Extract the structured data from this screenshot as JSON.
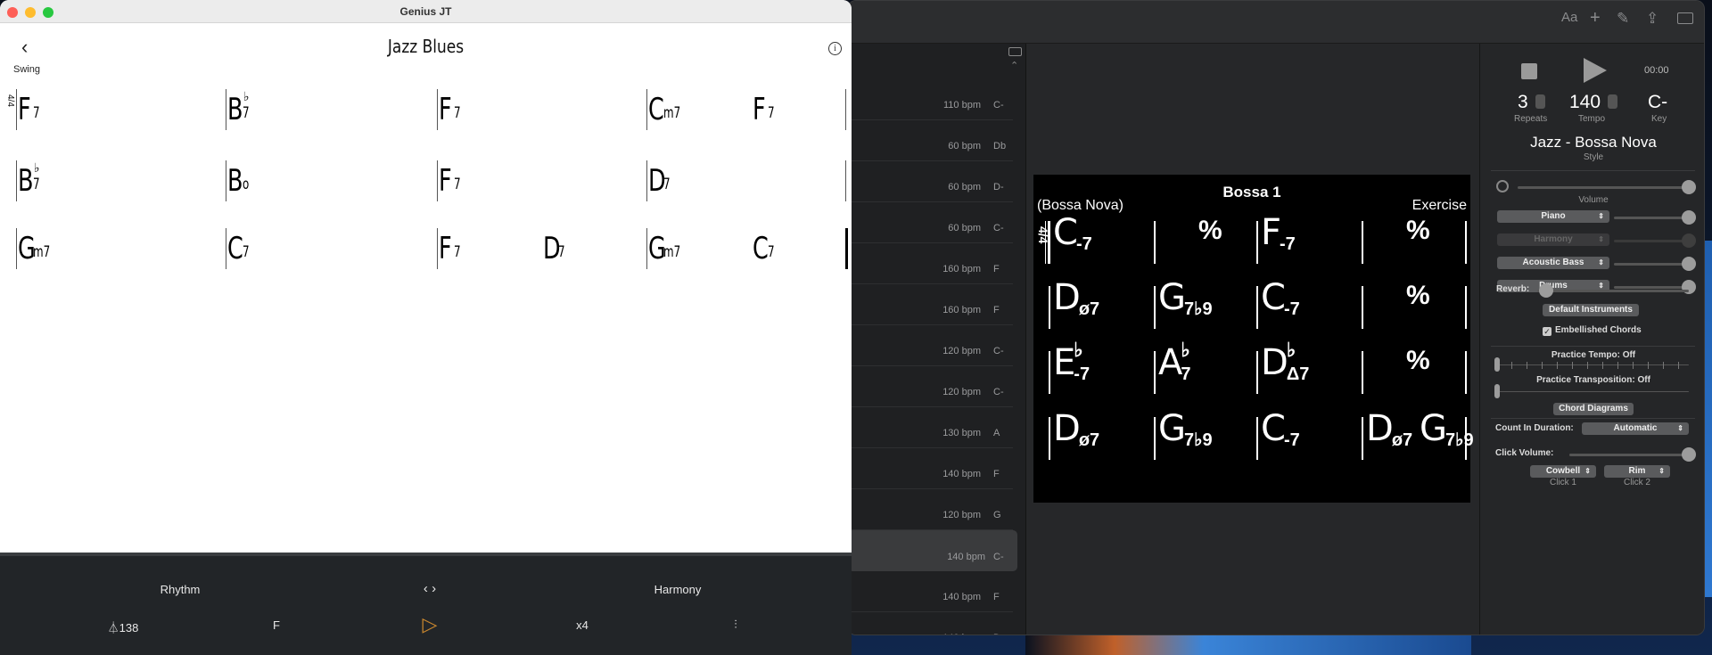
{
  "main_window": {
    "toolbar": {
      "icons": [
        "font-icon",
        "plus-icon",
        "pencil-icon",
        "share-icon",
        "sidebar-icon"
      ],
      "font_label": "Aa"
    },
    "list": {
      "rows": [
        {
          "tempo": "110 bpm",
          "key": "C-"
        },
        {
          "tempo": "60 bpm",
          "key": "Db"
        },
        {
          "tempo": "60 bpm",
          "key": "D-"
        },
        {
          "tempo": "60 bpm",
          "key": "C-"
        },
        {
          "tempo": "160 bpm",
          "key": "F"
        },
        {
          "tempo": "160 bpm",
          "key": "F"
        },
        {
          "tempo": "120 bpm",
          "key": "C-"
        },
        {
          "tempo": "120 bpm",
          "key": "C-"
        },
        {
          "tempo": "130 bpm",
          "key": "A"
        },
        {
          "tempo": "140 bpm",
          "key": "F"
        },
        {
          "tempo": "120 bpm",
          "key": "G"
        },
        {
          "tempo": "140 bpm",
          "key": "C-",
          "selected": true
        },
        {
          "tempo": "140 bpm",
          "key": "F"
        },
        {
          "tempo": "140 bpm",
          "key": "D-"
        }
      ]
    },
    "chart": {
      "title": "Bossa 1",
      "style": "(Bossa Nova)",
      "composer": "Exercise",
      "time_signature": "4/4",
      "rows": [
        [
          [
            "C",
            "",
            "-7"
          ],
          [
            "%"
          ],
          [
            "F",
            "",
            "-7"
          ],
          [
            "%"
          ]
        ],
        [
          [
            "D",
            "",
            "ø7"
          ],
          [
            "G",
            "",
            "7♭9"
          ],
          [
            "C",
            "",
            "-7"
          ],
          [
            "%"
          ]
        ],
        [
          [
            "E",
            "♭",
            "-7"
          ],
          [
            "A",
            "♭",
            "7"
          ],
          [
            "D",
            "♭",
            "Δ7"
          ],
          [
            "%"
          ]
        ],
        [
          [
            "D",
            "",
            "ø7"
          ],
          [
            "G",
            "",
            "7♭9"
          ],
          [
            "C",
            "",
            "-7"
          ],
          [
            "D",
            "",
            "ø7",
            "G",
            "",
            "7♭9"
          ]
        ]
      ]
    },
    "panel": {
      "time": "00:00",
      "repeats": "3",
      "repeats_label": "Repeats",
      "tempo": "140",
      "tempo_label": "Tempo",
      "key": "C-",
      "key_label": "Key",
      "style": "Jazz - Bossa Nova",
      "style_label": "Style",
      "volume_label": "Volume",
      "instruments": [
        {
          "name": "Piano",
          "level": 1.0,
          "enabled": true
        },
        {
          "name": "Harmony",
          "level": 1.0,
          "enabled": false
        },
        {
          "name": "Acoustic Bass",
          "level": 1.0,
          "enabled": true
        },
        {
          "name": "Drums",
          "level": 1.0,
          "enabled": true
        }
      ],
      "volume_level": 1.0,
      "reverb_label": "Reverb:",
      "reverb_level": 0.06,
      "default_instruments": "Default Instruments",
      "embellished_chords": "Embellished Chords",
      "embellished_checked": true,
      "practice_tempo": "Practice Tempo: Off",
      "practice_transposition": "Practice Transposition: Off",
      "chord_diagrams": "Chord Diagrams",
      "count_in_label": "Count In Duration:",
      "count_in_value": "Automatic",
      "click_volume_label": "Click Volume:",
      "click_volume_level": 1.0,
      "click1": "Cowbell",
      "click1_label": "Click 1",
      "click2": "Rim",
      "click2_label": "Click 2"
    }
  },
  "genius": {
    "window_title": "Genius JT",
    "song_title": "Jazz Blues",
    "style": "Swing",
    "time_signature": "4/4",
    "rows": [
      [
        [
          [
            "F",
            "",
            "7"
          ]
        ],
        [
          [
            "B",
            "♭",
            "7"
          ]
        ],
        [
          [
            "F",
            "",
            "7"
          ]
        ],
        [
          [
            "C",
            "",
            "m7"
          ],
          [
            "F",
            "",
            "7"
          ]
        ]
      ],
      [
        [
          [
            "B",
            "♭",
            "7"
          ]
        ],
        [
          [
            "B",
            "",
            "o"
          ]
        ],
        [
          [
            "F",
            "",
            "7"
          ]
        ],
        [
          [
            "D",
            "",
            "7"
          ]
        ]
      ],
      [
        [
          [
            "G",
            "",
            "m7"
          ]
        ],
        [
          [
            "C",
            "",
            "7"
          ]
        ],
        [
          [
            "F",
            "",
            "7"
          ],
          [
            "D",
            "",
            "7"
          ]
        ],
        [
          [
            "G",
            "",
            "m7"
          ],
          [
            "C",
            "",
            "7"
          ]
        ]
      ]
    ],
    "bottom": {
      "rhythm": "Rhythm",
      "harmony": "Harmony",
      "tempo": "138",
      "key": "F",
      "repeats": "x4",
      "play_color": "#c8862e"
    }
  }
}
